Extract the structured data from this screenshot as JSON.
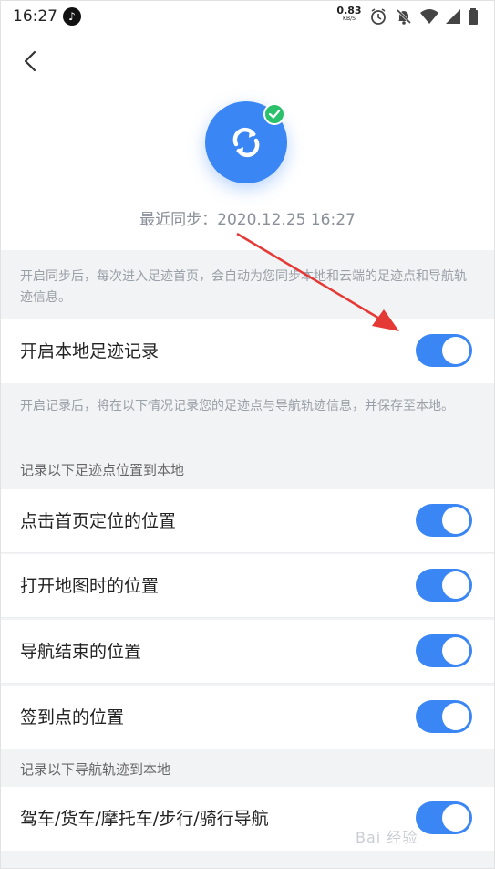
{
  "status_bar": {
    "time": "16:27",
    "app_glyph": "♪",
    "speed_value": "0.83",
    "speed_unit": "KB/S"
  },
  "header": {
    "last_sync": "最近同步：2020.12.25  16:27"
  },
  "sync_description": "开启同步后，每次进入足迹首页，会自动为您同步本地和云端的足迹点和导航轨迹信息。",
  "local_record": {
    "label": "开启本地足迹记录",
    "on": true
  },
  "record_description": "开启记录后，将在以下情况记录您的足迹点与导航轨迹信息，并保存至本地。",
  "section_points": {
    "title": "记录以下足迹点位置到本地",
    "items": [
      {
        "label": "点击首页定位的位置",
        "on": true
      },
      {
        "label": "打开地图时的位置",
        "on": true
      },
      {
        "label": "导航结束的位置",
        "on": true
      },
      {
        "label": "签到点的位置",
        "on": true
      }
    ]
  },
  "section_tracks": {
    "title": "记录以下导航轨迹到本地",
    "items": [
      {
        "label": "驾车/货车/摩托车/步行/骑行导航",
        "on": true
      }
    ]
  },
  "watermark": "Bai 经验",
  "colors": {
    "accent": "#3a86f4",
    "check": "#2bc06b",
    "annotation_arrow": "#e53935"
  }
}
